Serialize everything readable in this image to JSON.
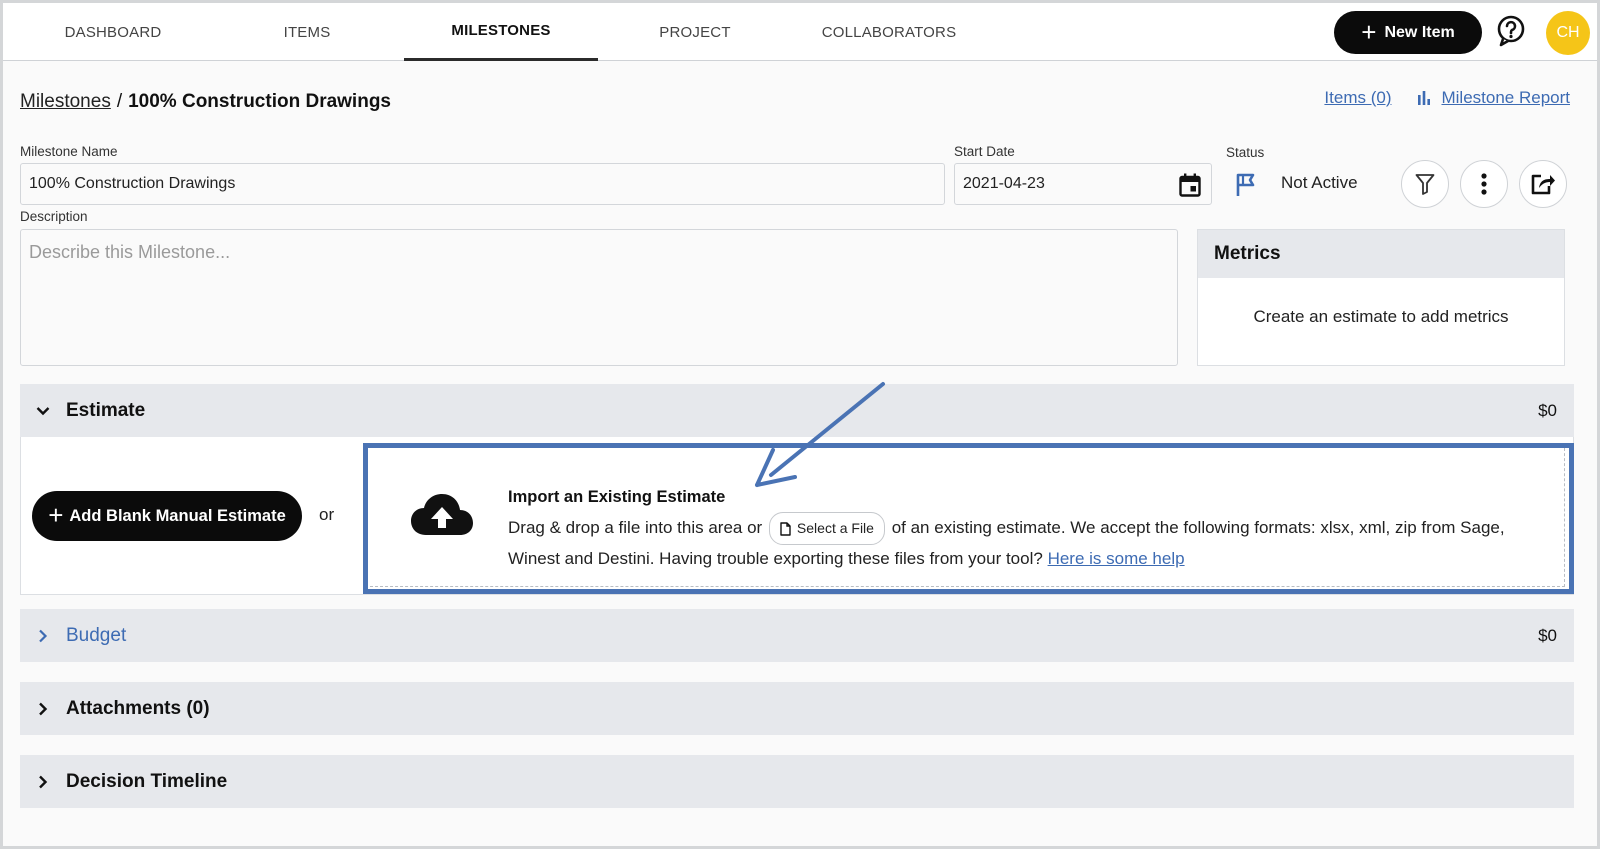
{
  "nav": {
    "tabs": [
      {
        "label": "DASHBOARD"
      },
      {
        "label": "ITEMS"
      },
      {
        "label": "MILESTONES",
        "active": true
      },
      {
        "label": "PROJECT"
      },
      {
        "label": "COLLABORATORS"
      }
    ],
    "new_item_label": "New Item",
    "avatar_initials": "CH"
  },
  "breadcrumb": {
    "parent": "Milestones",
    "separator": "/",
    "current": "100% Construction Drawings"
  },
  "links": {
    "items": "Items (0)",
    "report": "Milestone Report"
  },
  "form": {
    "name_label": "Milestone Name",
    "name_value": "100% Construction Drawings",
    "start_label": "Start Date",
    "start_value": "2021-04-23",
    "status_label": "Status",
    "status_value": "Not Active",
    "description_label": "Description",
    "description_placeholder": "Describe this Milestone..."
  },
  "metrics": {
    "title": "Metrics",
    "empty_text": "Create an estimate to add metrics"
  },
  "estimate": {
    "title": "Estimate",
    "amount": "$0",
    "add_blank_label": "Add Blank Manual Estimate",
    "or_text": "or",
    "import_title": "Import an Existing Estimate",
    "import_text_before": "Drag & drop a file into this area or",
    "select_file_label": "Select a File",
    "import_text_after": "of an existing estimate. We accept the following formats: xlsx, xml, zip from Sage, Winest and Destini. Having trouble exporting these files from your tool?",
    "help_link": "Here is some help"
  },
  "sections": {
    "budget_title": "Budget",
    "budget_amount": "$0",
    "attachments_title": "Attachments (0)",
    "timeline_title": "Decision Timeline"
  },
  "colors": {
    "accent_blue": "#3d6bb3",
    "highlight_blue": "#4a73b4",
    "avatar_yellow": "#f5c518"
  },
  "icons": [
    "plus-icon",
    "help-icon",
    "bar-chart-icon",
    "calendar-icon",
    "flag-icon",
    "filter-icon",
    "more-icon",
    "share-icon",
    "chevron-down-icon",
    "chevron-right-icon",
    "cloud-upload-icon",
    "file-icon"
  ]
}
